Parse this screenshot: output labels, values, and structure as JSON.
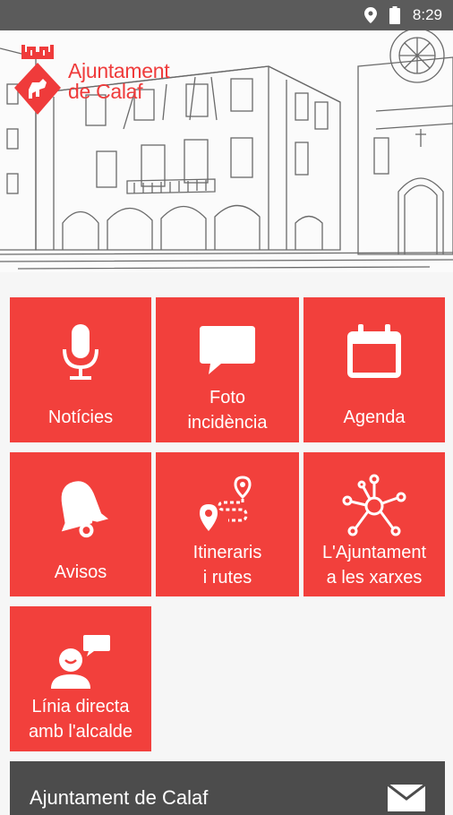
{
  "status_bar": {
    "time": "8:29",
    "icons": [
      "location-icon",
      "battery-icon"
    ]
  },
  "header": {
    "logo_line1": "Ajuntament",
    "logo_line2": "de Calaf"
  },
  "tiles": [
    {
      "label_line1": "Notícies",
      "label_line2": "",
      "icon": "microphone-icon"
    },
    {
      "label_line1": "Foto",
      "label_line2": "incidència",
      "icon": "chat-bubble-icon"
    },
    {
      "label_line1": "Agenda",
      "label_line2": "",
      "icon": "calendar-icon"
    },
    {
      "label_line1": "Avisos",
      "label_line2": "",
      "icon": "bell-icon"
    },
    {
      "label_line1": "Itineraris",
      "label_line2": "i rutes",
      "icon": "route-icon"
    },
    {
      "label_line1": "L'Ajuntament",
      "label_line2": "a les xarxes",
      "icon": "network-icon"
    },
    {
      "label_line1": "Línia directa",
      "label_line2": "amb l'alcalde",
      "icon": "person-chat-icon"
    }
  ],
  "footer": {
    "title": "Ajuntament de Calaf",
    "icon": "mail-icon"
  },
  "colors": {
    "accent": "#f2403c",
    "statusbar": "#5b5b5b",
    "footer": "#4c4c4c"
  }
}
